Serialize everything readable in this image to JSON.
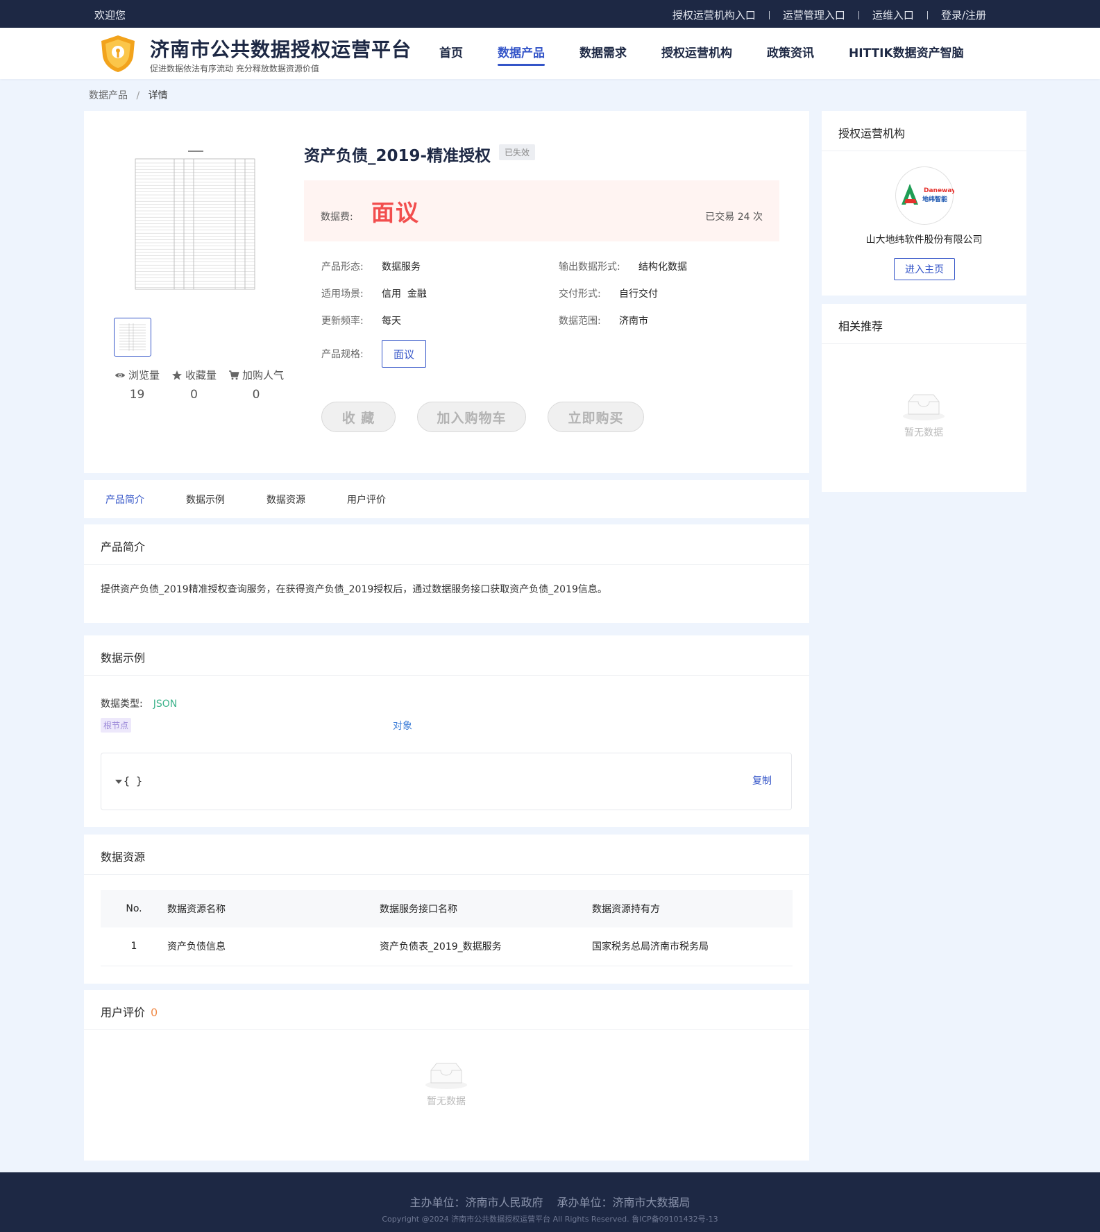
{
  "topbar": {
    "welcome": "欢迎您",
    "links": [
      "授权运营机构入口",
      "运营管理入口",
      "运维入口",
      "登录/注册"
    ]
  },
  "header": {
    "title": "济南市公共数据授权运营平台",
    "subtitle": "促进数据依法有序流动 充分释放数据资源价值",
    "nav": [
      "首页",
      "数据产品",
      "数据需求",
      "授权运营机构",
      "政策资讯",
      "HITTIK数据资产智脑"
    ],
    "active_nav": "数据产品"
  },
  "breadcrumb": {
    "parent": "数据产品",
    "separator": "/",
    "current": "详情"
  },
  "product": {
    "title": "资产负债_2019-精准授权",
    "status": "已失效",
    "price_label": "数据费:",
    "price": "面议",
    "traded": "已交易 24 次",
    "attributes": {
      "form_label": "产品形态:",
      "form": "数据服务",
      "output_label": "输出数据形式:",
      "output": "结构化数据",
      "scene_label": "适用场景:",
      "scene": "信用  金融",
      "delivery_label": "交付形式:",
      "delivery": "自行交付",
      "freq_label": "更新频率:",
      "freq": "每天",
      "range_label": "数据范围:",
      "range": "济南市",
      "spec_label": "产品规格:",
      "spec": "面议"
    },
    "stats": [
      {
        "label": "浏览量",
        "value": "19",
        "icon": "eye-icon"
      },
      {
        "label": "收藏量",
        "value": "0",
        "icon": "star-icon"
      },
      {
        "label": "加购人气",
        "value": "0",
        "icon": "cart-icon"
      }
    ],
    "buttons": {
      "favorite": "收 藏",
      "cart": "加入购物车",
      "buy": "立即购买"
    }
  },
  "tabs": [
    "产品简介",
    "数据示例",
    "数据资源",
    "用户评价"
  ],
  "intro": {
    "title": "产品简介",
    "text": "提供资产负债_2019精准授权查询服务，在获得资产负债_2019授权后，通过数据服务接口获取资产负债_2019信息。"
  },
  "example": {
    "title": "数据示例",
    "type_label": "数据类型:",
    "type": "JSON",
    "root_tag": "根节点",
    "object_label": "对象",
    "code": "{ }",
    "copy": "复制"
  },
  "resources": {
    "title": "数据资源",
    "columns": [
      "No.",
      "数据资源名称",
      "数据服务接口名称",
      "数据资源持有方"
    ],
    "rows": [
      {
        "no": "1",
        "name": "资产负债信息",
        "api": "资产负债表_2019_数据服务",
        "owner": "国家税务总局济南市税务局"
      }
    ]
  },
  "reviews": {
    "title": "用户评价",
    "count": "0",
    "empty": "暂无数据"
  },
  "org": {
    "title": "授权运营机构",
    "logo_text": "Daneway",
    "logo_cn": "地纬智能",
    "name": "山大地纬软件股份有限公司",
    "button": "进入主页"
  },
  "recommend": {
    "title": "相关推荐",
    "empty": "暂无数据"
  },
  "footer": {
    "sponsor": "主办单位：济南市人民政府",
    "organizer": "承办单位：济南市大数据局",
    "copyright": "Copyright @2024 济南市公共数据授权运营平台 All Rights Reserved. 鲁ICP备09101432号-13"
  },
  "colors": {
    "primary": "#3455c8",
    "dark": "#1d2844",
    "price": "#f24e4e",
    "bg": "#eef4fd"
  }
}
